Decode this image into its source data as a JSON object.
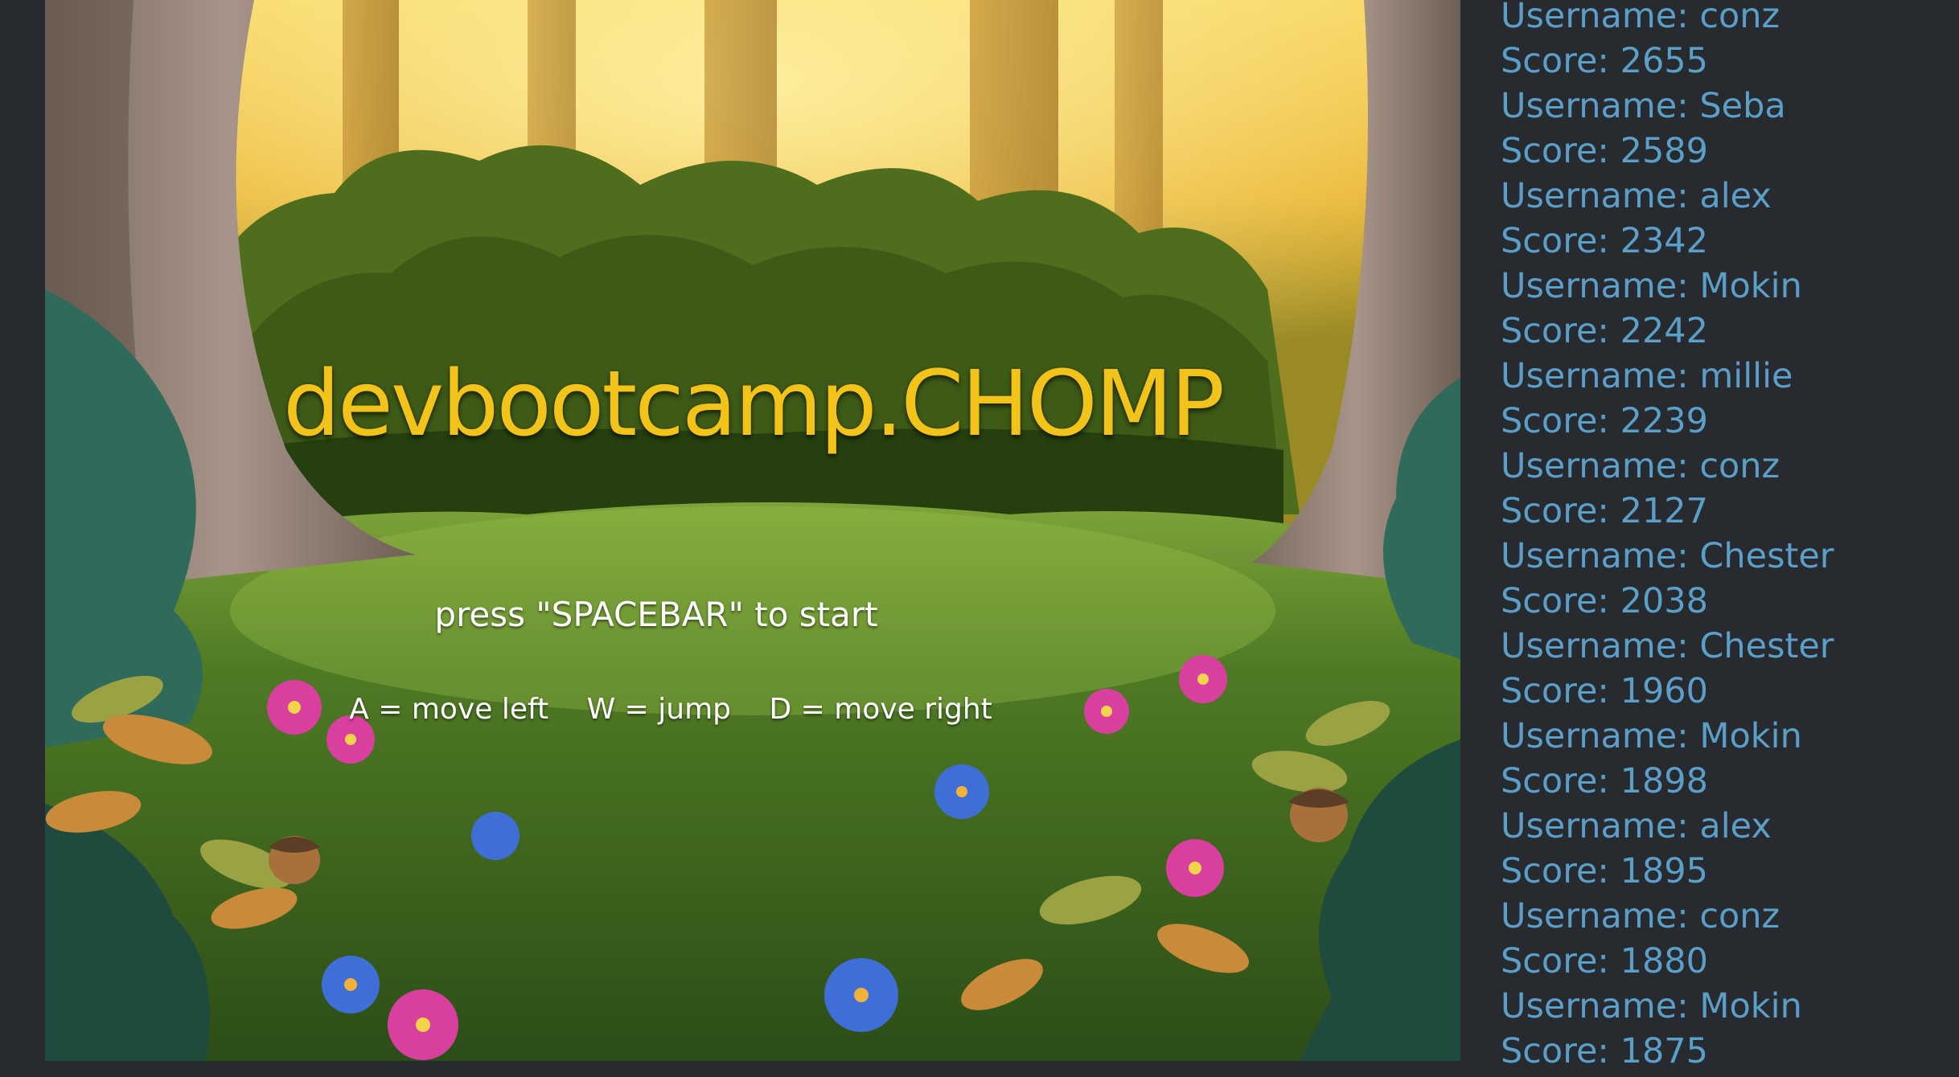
{
  "game": {
    "title": "devbootcamp.CHOMP",
    "start_prompt": "press \"SPACEBAR\" to start",
    "controls": [
      {
        "label": "A = move left"
      },
      {
        "label": "W = jump"
      },
      {
        "label": "D = move right"
      }
    ]
  },
  "scoreboard": {
    "entries": [
      {
        "username": "Username: conz",
        "score": "Score: 2655"
      },
      {
        "username": "Username: Seba",
        "score": "Score: 2589"
      },
      {
        "username": "Username: alex",
        "score": "Score: 2342"
      },
      {
        "username": "Username: Mokin",
        "score": "Score: 2242"
      },
      {
        "username": "Username: millie",
        "score": "Score: 2239"
      },
      {
        "username": "Username: conz",
        "score": "Score: 2127"
      },
      {
        "username": "Username: Chester",
        "score": "Score: 2038"
      },
      {
        "username": "Username: Chester",
        "score": "Score: 1960"
      },
      {
        "username": "Username: Mokin",
        "score": "Score: 1898"
      },
      {
        "username": "Username: alex",
        "score": "Score: 1895"
      },
      {
        "username": "Username: conz",
        "score": "Score: 1880"
      },
      {
        "username": "Username: Mokin",
        "score": "Score: 1875"
      }
    ]
  },
  "colors": {
    "page_background": "#272a2e",
    "title": "#f2c41a",
    "scoreboard_text": "#5b9fc9",
    "prompt_text": "#ffffff"
  }
}
